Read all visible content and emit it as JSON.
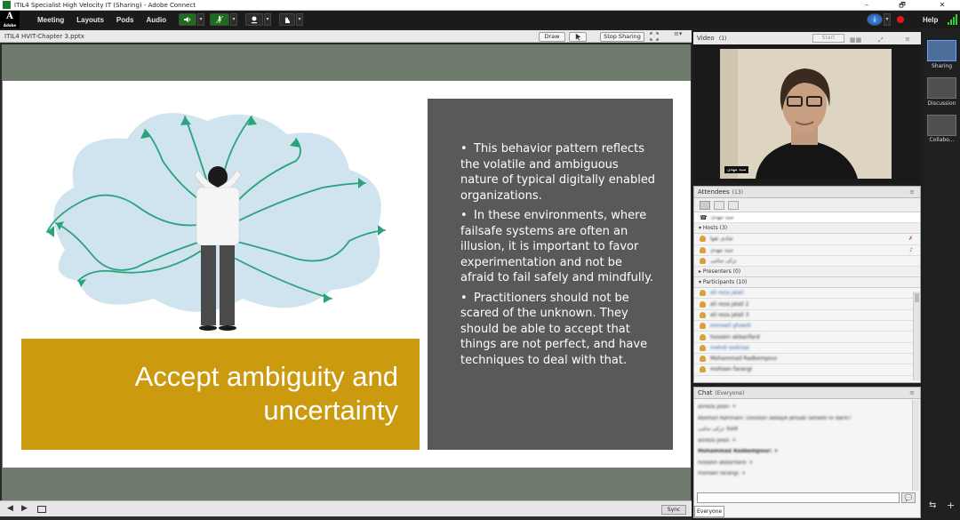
{
  "window": {
    "title": "ITIL4 Specialist High Velocity IT (Sharing) - Adobe Connect",
    "minimize": "–",
    "maximize": "🗗",
    "close": "✕"
  },
  "menubar": {
    "logo": "A",
    "logo_sub": "Adobe",
    "items": [
      "Meeting",
      "Layouts",
      "Pods",
      "Audio"
    ],
    "help": "Help"
  },
  "share_pod": {
    "file_name": "ITIL4 HVIT-Chapter 3.pptx",
    "draw_label": "Draw",
    "stop_sharing_label": "Stop Sharing",
    "menu_icon": "≡▾"
  },
  "slide": {
    "headline_line1": "Accept ambiguity and",
    "headline_line2": "uncertainty",
    "bullets": [
      "This behavior pattern reflects the volatile and ambiguous nature of typical digitally enabled organizations.",
      "In these environments, where failsafe systems are often an illusion, it is important to favor experimentation and not be afraid to fail safely and mindfully.",
      "Practitioners should not be scared of the unknown. They should be able to accept that things are not perfect, and have techniques to deal with that."
    ],
    "bullet_char": "•",
    "colors": {
      "accent": "#cb9a0e",
      "panel": "#595959",
      "arrow": "#2aa37c",
      "cloud": "#cfe4ee"
    }
  },
  "footer": {
    "sync_label": "Sync"
  },
  "video_pod": {
    "title": "Video",
    "count": "(1)",
    "start_label": "Start",
    "caption": "سید مهدی"
  },
  "attendees_pod": {
    "title": "Attendees",
    "count": "(13)",
    "me": "سید مهدی",
    "hosts_label": "Hosts (3)",
    "hosts": [
      "شادی تقوا",
      "سید مهدی",
      "ترکی سامی"
    ],
    "presenters_label": "Presenters (0)",
    "participants_label": "Participants (10)",
    "participants": [
      "ali reza jalali",
      "ali reza jalali 2",
      "ali reza jalali 3",
      "esmaeil ghaedi",
      "hossein akbarifard",
      "mehdi sedrizai",
      "Mohammad Radkempour",
      "mohsen farangi"
    ]
  },
  "chat_pod": {
    "title": "Chat",
    "scope": "(Everyone)",
    "lines": [
      "alireza jalali: +",
      "Abolfazl Rahmani: Doostan sedaye jensab Sehesti ro darin?",
      "ترکی سامی: balé",
      "alireza jalali: +",
      "Mohammad Radkempour: +",
      "hossein akbarifard: +",
      "mohsen farangi: +"
    ],
    "tab_label": "Everyone"
  },
  "layouts_rail": {
    "items": [
      "Sharing",
      "Discussion",
      "Collabo..."
    ]
  }
}
